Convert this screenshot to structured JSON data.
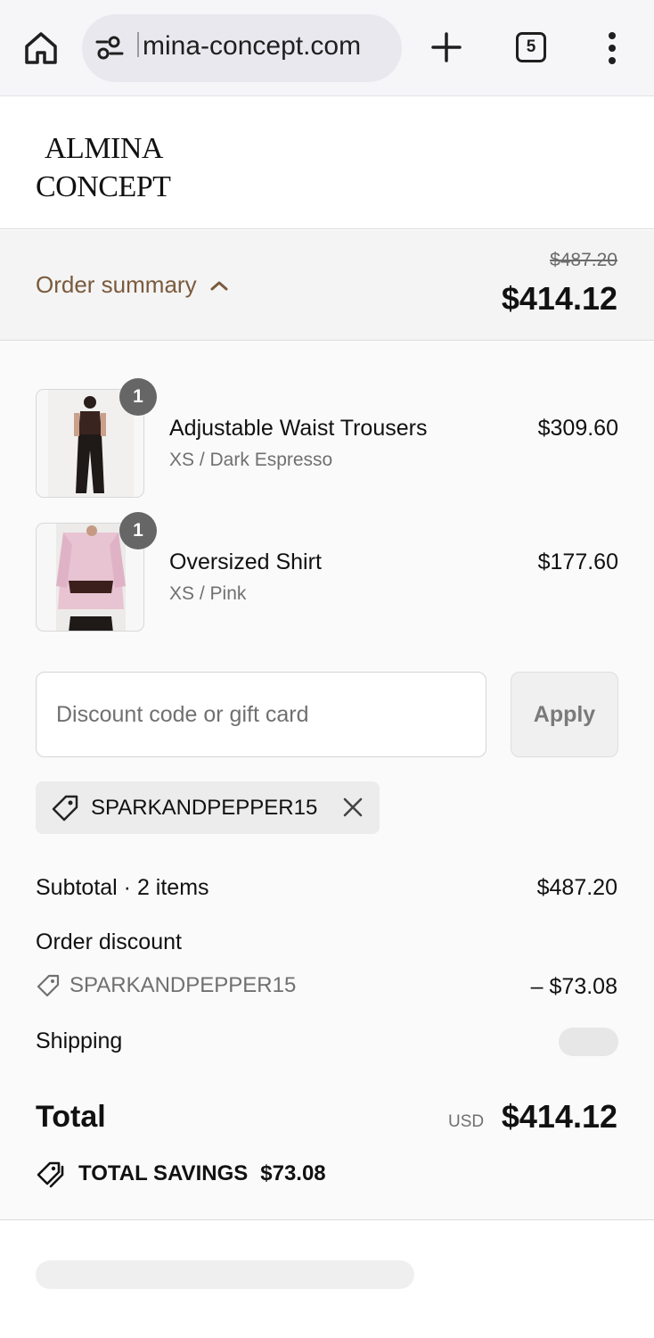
{
  "browser": {
    "url": "mina-concept.com",
    "tab_count": "5"
  },
  "store": {
    "logo_line1": "ALMINA",
    "logo_line2": "CONCEPT"
  },
  "summary": {
    "toggle_label": "Order summary",
    "original_price": "$487.20",
    "total_price": "$414.12"
  },
  "items": [
    {
      "title": "Adjustable Waist Trousers",
      "variant": "XS / Dark Espresso",
      "price": "$309.60",
      "quantity": "1"
    },
    {
      "title": "Oversized Shirt",
      "variant": "XS / Pink",
      "price": "$177.60",
      "quantity": "1"
    }
  ],
  "discount": {
    "placeholder": "Discount code or gift card",
    "apply_label": "Apply",
    "applied_code": "SPARKANDPEPPER15"
  },
  "totals": {
    "subtotal_label": "Subtotal · 2 items",
    "subtotal_value": "$487.20",
    "order_discount_label": "Order discount",
    "discount_code": "SPARKANDPEPPER15",
    "discount_value": "– $73.08",
    "shipping_label": "Shipping",
    "total_label": "Total",
    "currency": "USD",
    "total_value": "$414.12",
    "savings_label": "TOTAL SAVINGS",
    "savings_value": "$73.08"
  },
  "colors": {
    "accent_brown": "#7a5a3c",
    "panel_bg": "#fafafa",
    "badge_gray": "#666666"
  }
}
